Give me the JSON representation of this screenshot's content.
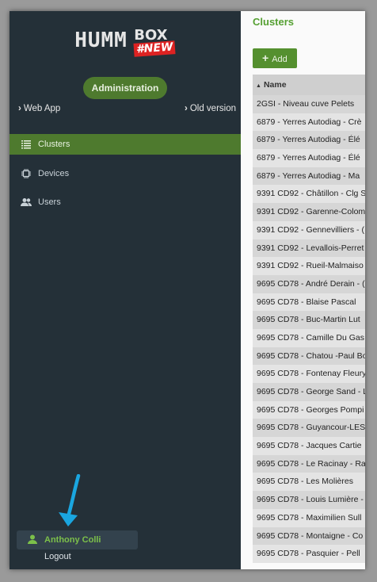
{
  "brand": {
    "logo_text": "HUMM",
    "logo_suffix": "BOX",
    "logo_badge": "#NEW"
  },
  "admin_button": "Administration",
  "quick_links": {
    "web_app": "Web App",
    "old_version": "Old version"
  },
  "nav": [
    {
      "label": "Clusters",
      "icon": "list-icon",
      "active": true
    },
    {
      "label": "Devices",
      "icon": "chip-icon",
      "active": false
    },
    {
      "label": "Users",
      "icon": "users-icon",
      "active": false
    }
  ],
  "user": {
    "name": "Anthony Colli",
    "logout": "Logout"
  },
  "main": {
    "title": "Clusters",
    "add_label": "Add",
    "table": {
      "header": "Name",
      "sort": "ascending",
      "rows": [
        "2GSI - Niveau cuve Pelets",
        "6879 - Yerres Autodiag - Crè",
        "6879 - Yerres Autodiag - Élé",
        "6879 - Yerres Autodiag - Élé",
        "6879 - Yerres Autodiag - Ma",
        "9391 CD92 - Châtillon - Clg S",
        "9391 CD92 - Garenne-Colom",
        "9391 CD92 - Gennevilliers - (",
        "9391 CD92 - Levallois-Perret",
        "9391 CD92 - Rueil-Malmaiso",
        "9695 CD78 - André Derain - (",
        "9695 CD78 - Blaise Pascal",
        "9695 CD78 - Buc-Martin Lut",
        "9695 CD78 - Camille Du Gas",
        "9695 CD78 - Chatou -Paul Bo",
        "9695 CD78 - Fontenay Fleury",
        "9695 CD78 - George Sand - L",
        "9695 CD78 - Georges Pompi",
        "9695 CD78 - Guyancour-LES",
        "9695 CD78 - Jacques Cartie",
        "9695 CD78 - Le Racinay - Ra",
        "9695 CD78 - Les Molières",
        "9695 CD78 - Louis Lumière -",
        "9695 CD78 - Maximilien Sull",
        "9695 CD78 - Montaigne - Co",
        "9695 CD78 - Pasquier - Pell"
      ]
    }
  },
  "colors": {
    "sidebar": "#243038",
    "accent": "#55902f",
    "accent_text": "#7cc04a",
    "arrow": "#1aa6e0"
  }
}
